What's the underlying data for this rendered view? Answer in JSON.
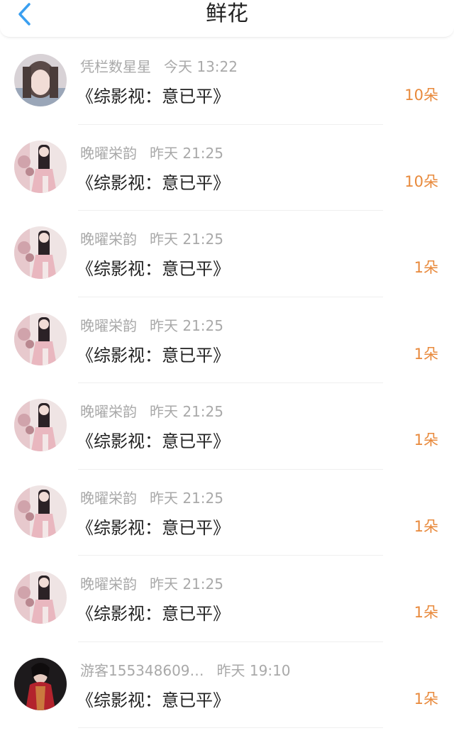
{
  "header": {
    "title": "鲜花",
    "back_icon": "chevron-left-icon",
    "accent": "#3a9ff0"
  },
  "colors": {
    "count": "#e8893b",
    "meta": "#a9a9a9",
    "text": "#222222"
  },
  "items": [
    {
      "name": "凭栏数星星",
      "time": "今天 13:22",
      "book": "《综影视：意已平》",
      "count": "10朵",
      "avatar": "avatar-girl-light"
    },
    {
      "name": "晚曜栄韵",
      "time": "昨天 21:25",
      "book": "《综影视：意已平》",
      "count": "10朵",
      "avatar": "avatar-girl-pink"
    },
    {
      "name": "晚曜栄韵",
      "time": "昨天 21:25",
      "book": "《综影视：意已平》",
      "count": "1朵",
      "avatar": "avatar-girl-pink"
    },
    {
      "name": "晚曜栄韵",
      "time": "昨天 21:25",
      "book": "《综影视：意已平》",
      "count": "1朵",
      "avatar": "avatar-girl-pink"
    },
    {
      "name": "晚曜栄韵",
      "time": "昨天 21:25",
      "book": "《综影视：意已平》",
      "count": "1朵",
      "avatar": "avatar-girl-pink"
    },
    {
      "name": "晚曜栄韵",
      "time": "昨天 21:25",
      "book": "《综影视：意已平》",
      "count": "1朵",
      "avatar": "avatar-girl-pink"
    },
    {
      "name": "晚曜栄韵",
      "time": "昨天 21:25",
      "book": "《综影视：意已平》",
      "count": "1朵",
      "avatar": "avatar-girl-pink"
    },
    {
      "name": "游客155348609…",
      "time": "昨天 19:10",
      "book": "《综影视：意已平》",
      "count": "1朵",
      "avatar": "avatar-girl-dark"
    }
  ]
}
